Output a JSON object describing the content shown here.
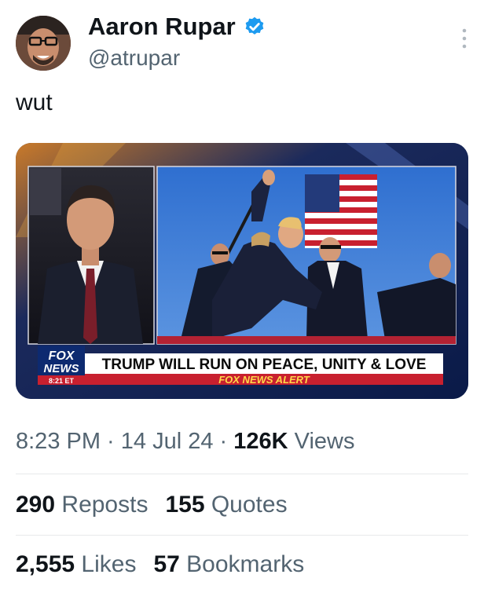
{
  "author": {
    "display_name": "Aaron Rupar",
    "handle": "@atrupar",
    "verified": true
  },
  "tweet": {
    "text": "wut"
  },
  "media": {
    "chyron_headline": "TRUMP WILL RUN ON PEACE, UNITY & LOVE",
    "chyron_alert": "FOX NEWS ALERT",
    "logo_line1": "FOX",
    "logo_line2": "NEWS",
    "time": "8:21 ET"
  },
  "meta": {
    "time": "8:23 PM",
    "sep1": " · ",
    "date": "14 Jul 24",
    "sep2": " · ",
    "views_count": "126K",
    "views_label": " Views"
  },
  "stats": {
    "reposts_count": "290",
    "reposts_label": " Reposts",
    "quotes_count": "155",
    "quotes_label": " Quotes",
    "likes_count": "2,555",
    "likes_label": " Likes",
    "bookmarks_count": "57",
    "bookmarks_label": " Bookmarks"
  },
  "colors": {
    "verified_blue": "#1d9bf0",
    "muted_text": "#536471",
    "primary_text": "#0f1419",
    "divider": "#e7e9ea"
  }
}
